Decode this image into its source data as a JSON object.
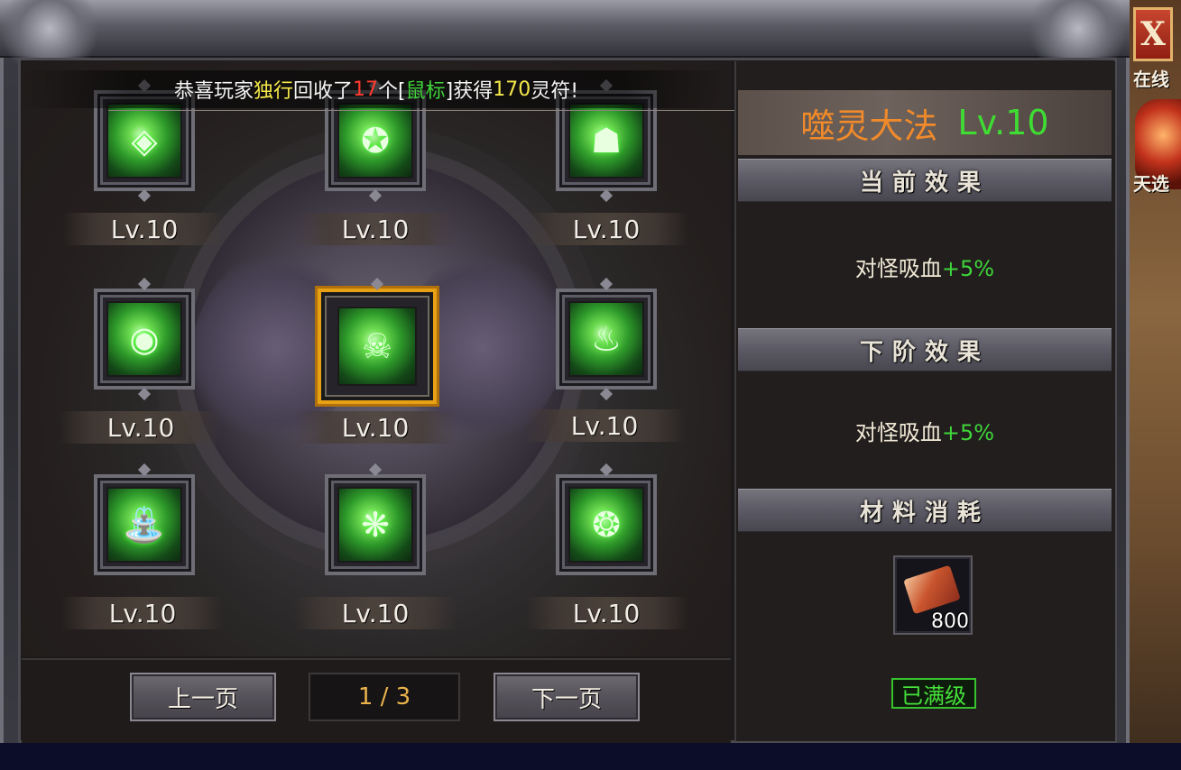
{
  "announcement": {
    "prefix": "恭喜玩家",
    "player": "独行",
    "mid": "回收了",
    "count": "17",
    "unit": "个[",
    "item": "鼠标",
    "mid2": "]获得",
    "reward": "170",
    "suffix": "灵符!"
  },
  "skill": {
    "name": "噬灵大法",
    "level": "Lv.10"
  },
  "sections": {
    "current": "当前效果",
    "next": "下阶效果",
    "material": "材料消耗"
  },
  "current_effect": {
    "label": "对怪吸血",
    "value": "+5%"
  },
  "next_effect": {
    "label": "对怪吸血",
    "value": "+5%"
  },
  "material": {
    "icon": "scroll-book-icon",
    "count": "800"
  },
  "maxed_label": "已满级",
  "slots": [
    {
      "icon": "shield-rune-icon",
      "level": "Lv.10"
    },
    {
      "icon": "emblem-icon",
      "level": "Lv.10"
    },
    {
      "icon": "tiger-icon",
      "level": "Lv.10"
    },
    {
      "icon": "eye-orb-icon",
      "level": "Lv.10"
    },
    {
      "icon": "skull-ring-icon",
      "level": "Lv.10",
      "selected": true
    },
    {
      "icon": "flame-icon",
      "level": "Lv.10"
    },
    {
      "icon": "fountain-icon",
      "level": "Lv.10"
    },
    {
      "icon": "spirit-icon",
      "level": "Lv.10"
    },
    {
      "icon": "swirl-icon",
      "level": "Lv.10"
    }
  ],
  "pager": {
    "prev": "上一页",
    "indicator": "1 / 3",
    "next": "下一页"
  },
  "close_label": "X",
  "sidebar": {
    "label1": "在线",
    "label2": "天选"
  },
  "colors": {
    "skill_name": "#f08a2a",
    "level_green": "#3fdc34",
    "accent_gold": "#e8a015",
    "effect_value": "#3fd43a"
  }
}
